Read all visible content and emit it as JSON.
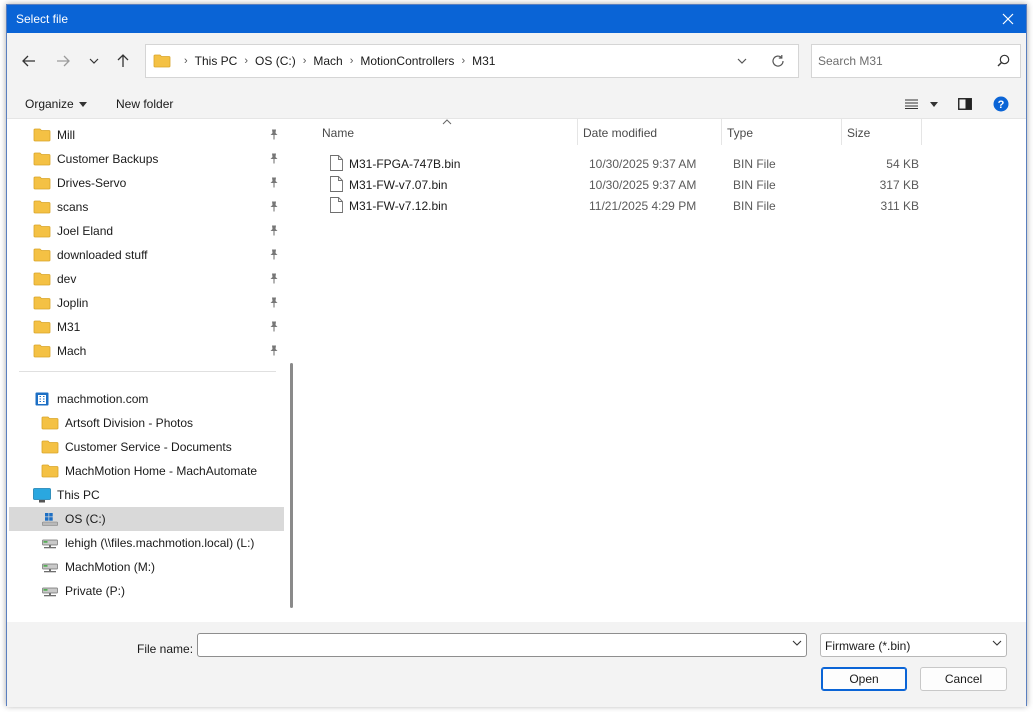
{
  "window": {
    "title": "Select file",
    "accent": "#0a64d6"
  },
  "breadcrumb": [
    "This PC",
    "OS (C:)",
    "Mach",
    "MotionControllers",
    "M31"
  ],
  "search": {
    "placeholder": "Search M31",
    "value": ""
  },
  "commandbar": {
    "organize": "Organize",
    "new_folder": "New folder"
  },
  "quick_access": [
    {
      "label": "Mill",
      "icon": "folder-icon",
      "pinned": true
    },
    {
      "label": "Customer Backups",
      "icon": "folder-icon",
      "pinned": true
    },
    {
      "label": "Drives-Servo",
      "icon": "folder-icon",
      "pinned": true
    },
    {
      "label": "scans",
      "icon": "folder-icon",
      "pinned": true
    },
    {
      "label": "Joel Eland",
      "icon": "folder-icon",
      "pinned": true
    },
    {
      "label": "downloaded stuff",
      "icon": "folder-icon",
      "pinned": true
    },
    {
      "label": "dev",
      "icon": "folder-icon",
      "pinned": true
    },
    {
      "label": "Joplin",
      "icon": "folder-icon",
      "pinned": true
    },
    {
      "label": "M31",
      "icon": "folder-icon",
      "pinned": true
    },
    {
      "label": "Mach",
      "icon": "folder-icon",
      "pinned": true
    }
  ],
  "locations": [
    {
      "label": "machmotion.com",
      "icon": "building-icon",
      "selected": false
    },
    {
      "label": "Artsoft Division - Photos",
      "icon": "folder-icon",
      "selected": false
    },
    {
      "label": "Customer Service - Documents",
      "icon": "folder-icon",
      "selected": false
    },
    {
      "label": "MachMotion Home - MachAutomate",
      "icon": "folder-icon",
      "selected": false
    },
    {
      "label": "This PC",
      "icon": "monitor-icon",
      "selected": false
    },
    {
      "label": "OS (C:)",
      "icon": "windows-drive-icon",
      "selected": true
    },
    {
      "label": "lehigh (\\\\files.machmotion.local) (L:)",
      "icon": "network-drive-icon",
      "selected": false
    },
    {
      "label": "MachMotion (M:)",
      "icon": "network-drive-icon",
      "selected": false
    },
    {
      "label": "Private (P:)",
      "icon": "network-drive-icon",
      "selected": false
    }
  ],
  "columns": {
    "name": "Name",
    "date": "Date modified",
    "type": "Type",
    "size": "Size"
  },
  "files": [
    {
      "name": "M31-FPGA-747B.bin",
      "date": "10/30/2025 9:37 AM",
      "type": "BIN File",
      "size": "54 KB"
    },
    {
      "name": "M31-FW-v7.07.bin",
      "date": "10/30/2025 9:37 AM",
      "type": "BIN File",
      "size": "317 KB"
    },
    {
      "name": "M31-FW-v7.12.bin",
      "date": "11/21/2025 4:29 PM",
      "type": "BIN File",
      "size": "311 KB"
    }
  ],
  "footer": {
    "file_name_label": "File name:",
    "file_name_value": "",
    "file_type": "Firmware (*.bin)",
    "open": "Open",
    "cancel": "Cancel"
  }
}
